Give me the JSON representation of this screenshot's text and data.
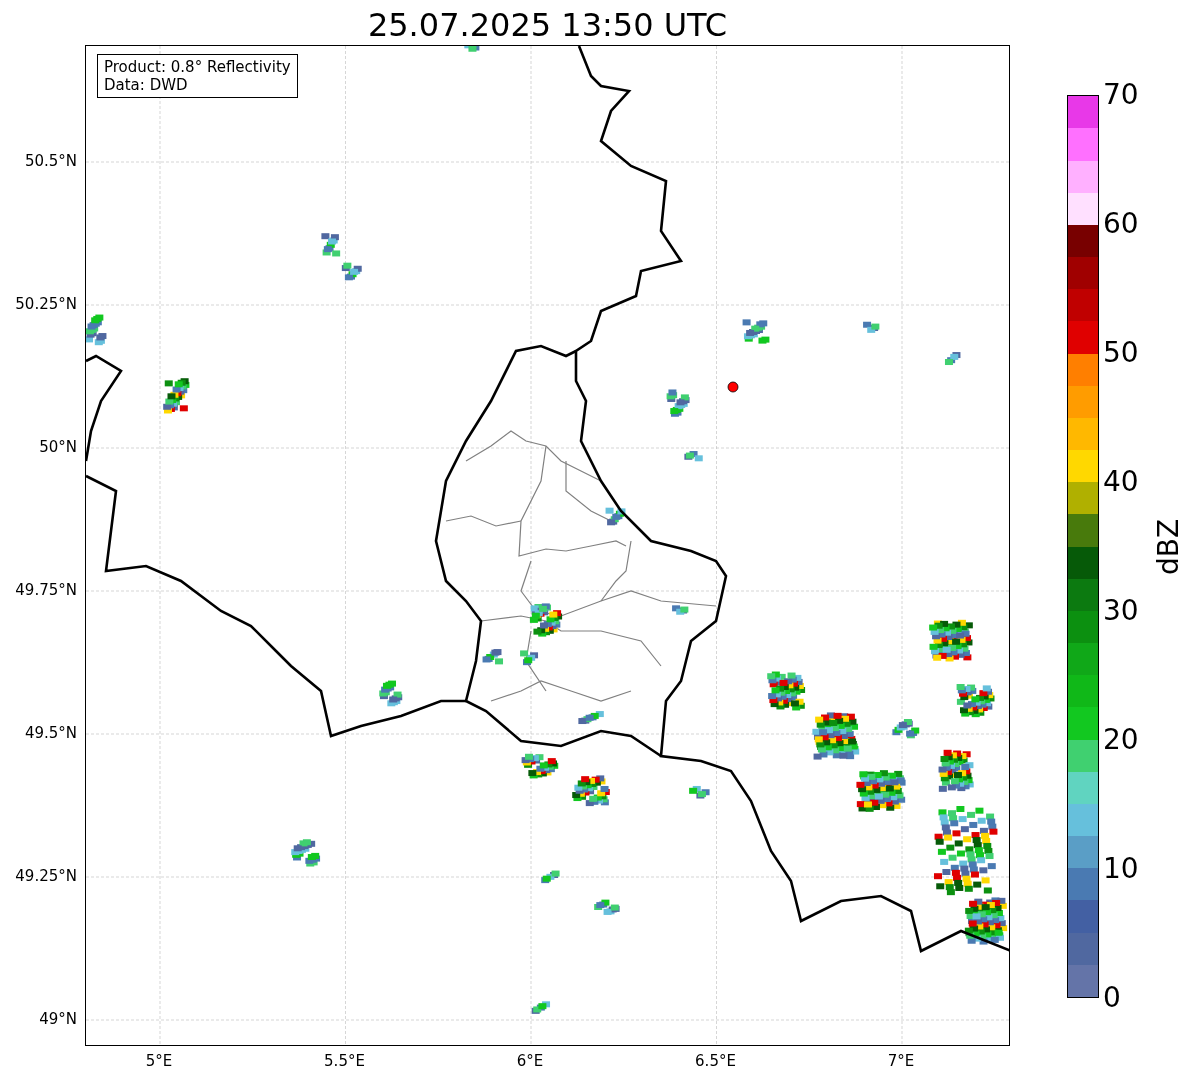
{
  "title": "25.07.2025 13:50 UTC",
  "info_box": {
    "lines": [
      "Product: 0.8° Reflectivity",
      "Data: DWD"
    ]
  },
  "map": {
    "lat_ticks": [
      "50.5°N",
      "50.25°N",
      "50°N",
      "49.75°N",
      "49.5°N",
      "49.25°N",
      "49°N"
    ],
    "lon_ticks": [
      "5°E",
      "5.5°E",
      "6°E",
      "6.5°E",
      "7°E"
    ]
  },
  "colorbar": {
    "label": "dBZ",
    "ticks": [
      "70",
      "60",
      "50",
      "40",
      "30",
      "20",
      "10",
      "0"
    ],
    "segments": [
      {
        "color": "#6474a8"
      },
      {
        "color": "#5068a0"
      },
      {
        "color": "#4360a3"
      },
      {
        "color": "#4a7ab2"
      },
      {
        "color": "#5a9ec6"
      },
      {
        "color": "#66c0dc"
      },
      {
        "color": "#60d4c0"
      },
      {
        "color": "#40d070"
      },
      {
        "color": "#12c820"
      },
      {
        "color": "#10b818"
      },
      {
        "color": "#10a818"
      },
      {
        "color": "#0c9010"
      },
      {
        "color": "#0c7a10"
      },
      {
        "color": "#065a08"
      },
      {
        "color": "#487a0c"
      },
      {
        "color": "#b0b000"
      },
      {
        "color": "#ffd800"
      },
      {
        "color": "#ffb800"
      },
      {
        "color": "#ff9c00"
      },
      {
        "color": "#ff7f00"
      },
      {
        "color": "#e00000"
      },
      {
        "color": "#c00000"
      },
      {
        "color": "#a00000"
      },
      {
        "color": "#780000"
      },
      {
        "color": "#ffe0ff"
      },
      {
        "color": "#ffb0ff"
      },
      {
        "color": "#ff70ff"
      },
      {
        "color": "#e838e8"
      }
    ]
  }
}
